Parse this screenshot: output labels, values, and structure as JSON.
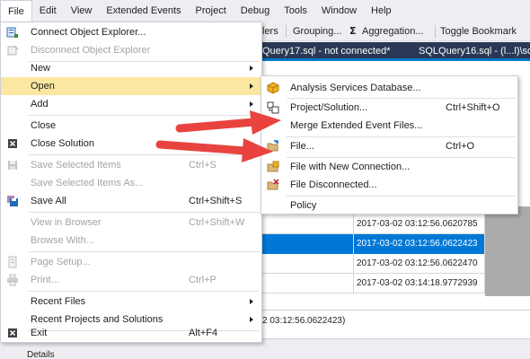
{
  "menubar": [
    "File",
    "Edit",
    "View",
    "Extended Events",
    "Project",
    "Debug",
    "Tools",
    "Window",
    "Help"
  ],
  "toolbar": {
    "partial_left": "lers",
    "grouping": "Grouping...",
    "sigma": "Σ",
    "aggregation": "Aggregation...",
    "toggle_bookmark": "Toggle Bookmark"
  },
  "tabs": {
    "active_partial": "Query17.sql - not connected*",
    "other": "SQLQuery16.sql - (l...l)\\sql"
  },
  "file_menu": [
    {
      "label": "Connect Object Explorer...",
      "key": "",
      "icon": "connect-object-explorer-icon",
      "disabled": false,
      "submenu": false
    },
    {
      "label": "Disconnect Object Explorer",
      "key": "",
      "icon": "disconnect-icon",
      "disabled": true,
      "submenu": false
    },
    {
      "label": "New",
      "key": "",
      "icon": "",
      "disabled": false,
      "submenu": true
    },
    {
      "label": "Open",
      "key": "",
      "icon": "",
      "disabled": false,
      "submenu": true
    },
    {
      "label": "Add",
      "key": "",
      "icon": "",
      "disabled": false,
      "submenu": true
    },
    {
      "label": "Close",
      "key": "",
      "icon": "",
      "disabled": false,
      "submenu": false
    },
    {
      "label": "Close Solution",
      "key": "",
      "icon": "close-solution-icon",
      "disabled": false,
      "submenu": false
    },
    {
      "label": "Save Selected Items",
      "key": "Ctrl+S",
      "icon": "save-icon",
      "disabled": true,
      "submenu": false
    },
    {
      "label": "Save Selected Items As...",
      "key": "",
      "icon": "",
      "disabled": true,
      "submenu": false
    },
    {
      "label": "Save All",
      "key": "Ctrl+Shift+S",
      "icon": "save-all-icon",
      "disabled": false,
      "submenu": false
    },
    {
      "label": "View in Browser",
      "key": "Ctrl+Shift+W",
      "icon": "",
      "disabled": true,
      "submenu": false
    },
    {
      "label": "Browse With...",
      "key": "",
      "icon": "",
      "disabled": true,
      "submenu": false
    },
    {
      "label": "Page Setup...",
      "key": "",
      "icon": "page-setup-icon",
      "disabled": true,
      "submenu": false
    },
    {
      "label": "Print...",
      "key": "Ctrl+P",
      "icon": "print-icon",
      "disabled": true,
      "submenu": false
    },
    {
      "label": "Recent Files",
      "key": "",
      "icon": "",
      "disabled": false,
      "submenu": true
    },
    {
      "label": "Recent Projects and Solutions",
      "key": "",
      "icon": "",
      "disabled": false,
      "submenu": true
    },
    {
      "label": "Exit",
      "key": "Alt+F4",
      "icon": "exit-icon",
      "disabled": false,
      "submenu": false
    }
  ],
  "open_submenu": [
    {
      "label": "Analysis Services Database...",
      "key": "",
      "icon": "analysis-services-database-icon"
    },
    {
      "label": "Project/Solution...",
      "key": "Ctrl+Shift+O",
      "icon": "project-solution-icon"
    },
    {
      "label": "Merge Extended Event Files...",
      "key": "",
      "icon": ""
    },
    {
      "label": "File...",
      "key": "Ctrl+O",
      "icon": "open-file-icon"
    },
    {
      "label": "File with New Connection...",
      "key": "",
      "icon": "file-new-connection-icon"
    },
    {
      "label": "File Disconnected...",
      "key": "",
      "icon": "file-disconnected-icon"
    },
    {
      "label": "Policy",
      "key": "",
      "icon": ""
    }
  ],
  "grid": {
    "timestamps": [
      "2017-03-02 03:12:56.0620785",
      "2017-03-02 03:12:56.0622423",
      "2017-03-02 03:12:56.0622470",
      "2017-03-02 03:14:18.9772939"
    ],
    "selected_index": 1,
    "details_partial": "2 03:12:56.0622423)",
    "bottom_tab": "Details"
  },
  "colors": {
    "hover_highlight": "#fbe7a1",
    "selection": "#0078d7",
    "tab_strip": "#293955",
    "arrow": "#e8433f"
  }
}
